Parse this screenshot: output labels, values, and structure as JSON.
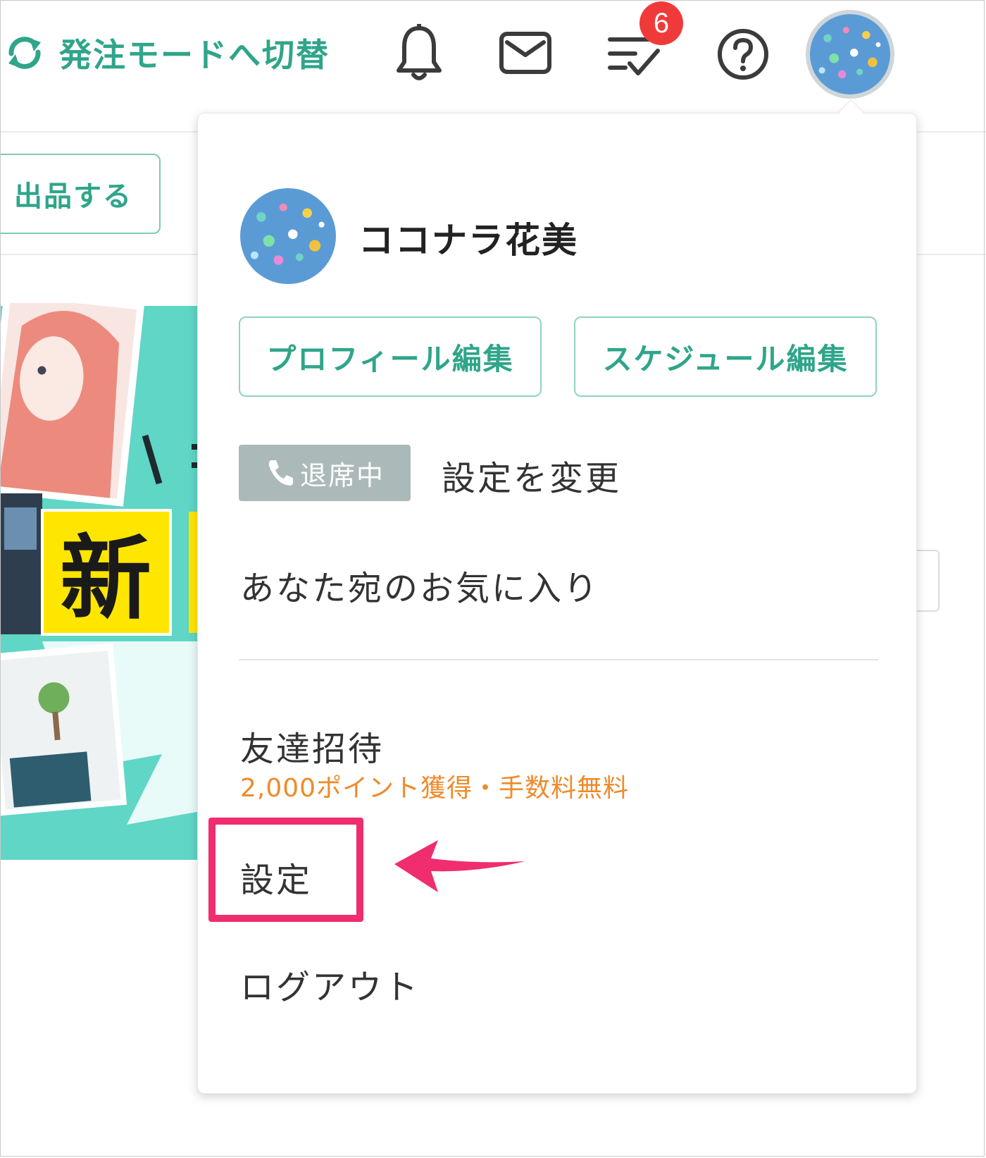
{
  "header": {
    "switch_mode_label": "発注モードへ切替",
    "todo_badge_count": "6"
  },
  "page": {
    "listing_button_label": "出品する",
    "banner_text": "新"
  },
  "dropdown": {
    "username": "ココナラ花美",
    "profile_edit_label": "プロフィール編集",
    "schedule_edit_label": "スケジュール編集",
    "status_badge_label": "退席中",
    "change_settings_label": "設定を変更",
    "favorites_label": "あなた宛のお気に入り",
    "invite_label": "友達招待",
    "invite_sub_label": "2,000ポイント獲得・手数料無料",
    "settings_label": "設定",
    "logout_label": "ログアウト"
  },
  "colors": {
    "brand_green": "#2fa58a",
    "badge_red": "#f03a3a",
    "status_gray": "#abb9b9",
    "invite_orange": "#ef8a2a",
    "highlight_pink": "#f02d6e"
  },
  "icons": [
    "sync-icon",
    "bell-icon",
    "mail-icon",
    "todo-check-icon",
    "help-icon",
    "phone-icon",
    "arrow-icon"
  ]
}
